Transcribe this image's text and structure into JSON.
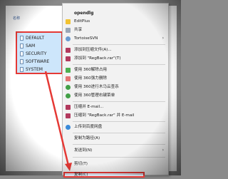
{
  "explorer": {
    "column_header": "名称",
    "files": [
      "DEFAULT",
      "SAM",
      "SECURITY",
      "SOFTWARE",
      "SYSTEM"
    ]
  },
  "context_menu": {
    "items": [
      {
        "label": "opendlg",
        "icon": "none",
        "bold": true
      },
      {
        "label": "EditPlus",
        "icon": "editplus-icon"
      },
      {
        "label": "共享",
        "icon": "share-icon"
      },
      {
        "label": "TortoiseSVN",
        "icon": "tortoisesvn-icon",
        "submenu": true
      },
      {
        "label": "添加到压缩文件(A)...",
        "icon": "winrar-icon"
      },
      {
        "label": "添加到 \"RegBack.rar\"(T)",
        "icon": "winrar-icon"
      },
      {
        "label": "使用 360解除占用",
        "icon": "360-icon"
      },
      {
        "label": "使用 360强力删除",
        "icon": "360-icon"
      },
      {
        "label": "使用 360进行木马云查杀",
        "icon": "360-green-icon"
      },
      {
        "label": "使用 360管理右键菜单",
        "icon": "360-green-icon"
      },
      {
        "label": "压缩并 E-mail...",
        "icon": "winrar-icon"
      },
      {
        "label": "压缩到 \"RegBack.rar\" 并 E-mail",
        "icon": "winrar-icon"
      },
      {
        "label": "上传到百度网盘",
        "icon": "baidu-icon"
      },
      {
        "label": "复制为路径(A)",
        "icon": "none"
      },
      {
        "label": "发送到(N)",
        "icon": "none",
        "submenu": true
      },
      {
        "label": "剪切(T)",
        "icon": "none"
      },
      {
        "label": "复制(C)",
        "icon": "none"
      }
    ]
  },
  "colors": {
    "highlight_red": "#e53935",
    "selection_blue": "#cde6fb",
    "menu_bg": "#f2f2f2"
  }
}
